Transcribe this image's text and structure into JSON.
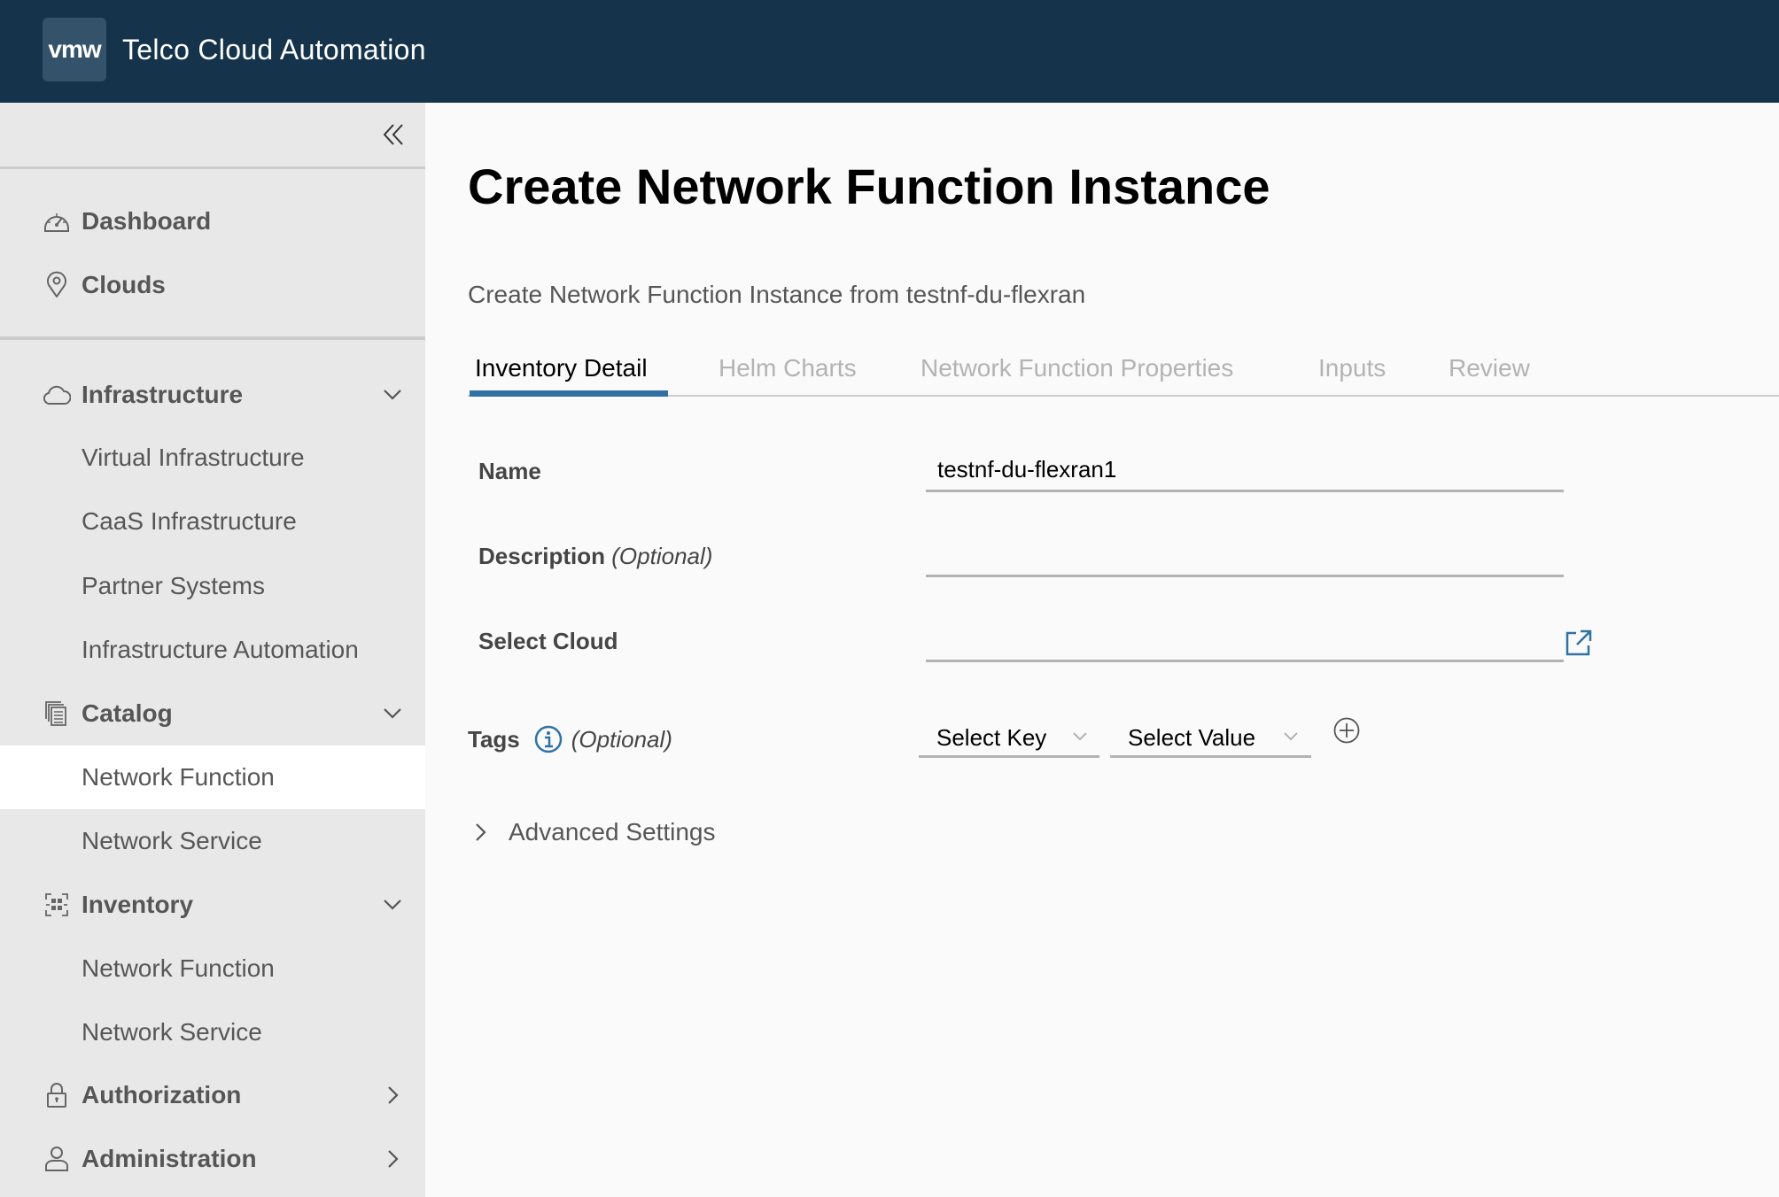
{
  "header": {
    "logo_text": "vmw",
    "app_title": "Telco Cloud Automation"
  },
  "sidebar": {
    "collapse_icon": "double-chevron-left-icon",
    "items": [
      {
        "label": "Dashboard",
        "icon": "dashboard-icon",
        "type": "group"
      },
      {
        "label": "Clouds",
        "icon": "map-pin-icon",
        "type": "group"
      },
      {
        "label": "Infrastructure",
        "icon": "cloud-icon",
        "type": "group",
        "expanded": true
      },
      {
        "label": "Virtual Infrastructure",
        "type": "child"
      },
      {
        "label": "CaaS Infrastructure",
        "type": "child"
      },
      {
        "label": "Partner Systems",
        "type": "child"
      },
      {
        "label": "Infrastructure Automation",
        "type": "child"
      },
      {
        "label": "Catalog",
        "icon": "catalog-icon",
        "type": "group",
        "expanded": true
      },
      {
        "label": "Network Function",
        "type": "child",
        "active": true
      },
      {
        "label": "Network Service",
        "type": "child"
      },
      {
        "label": "Inventory",
        "icon": "inventory-icon",
        "type": "group",
        "expanded": true
      },
      {
        "label": "Network Function",
        "type": "child"
      },
      {
        "label": "Network Service",
        "type": "child"
      },
      {
        "label": "Authorization",
        "icon": "lock-icon",
        "type": "group",
        "expanded": false
      },
      {
        "label": "Administration",
        "icon": "user-icon",
        "type": "group",
        "expanded": false
      }
    ]
  },
  "main": {
    "title": "Create Network Function Instance",
    "subtitle": "Create Network Function Instance from testnf-du-flexran",
    "tabs": [
      {
        "label": "Inventory Detail",
        "active": true
      },
      {
        "label": "Helm Charts",
        "active": false
      },
      {
        "label": "Network Function Properties",
        "active": false
      },
      {
        "label": "Inputs",
        "active": false
      },
      {
        "label": "Review",
        "active": false
      }
    ],
    "form": {
      "name": {
        "label": "Name",
        "value": "testnf-du-flexran1"
      },
      "description": {
        "label": "Description",
        "optional": "(Optional)",
        "value": ""
      },
      "select_cloud": {
        "label": "Select Cloud",
        "value": ""
      },
      "tags": {
        "label": "Tags",
        "optional": "(Optional)",
        "key_placeholder": "Select Key",
        "value_placeholder": "Select Value"
      },
      "advanced_settings": "Advanced Settings"
    }
  },
  "colors": {
    "header_bg": "#15344c",
    "accent": "#2f72a3",
    "sidebar_bg": "#e8e8e8"
  }
}
